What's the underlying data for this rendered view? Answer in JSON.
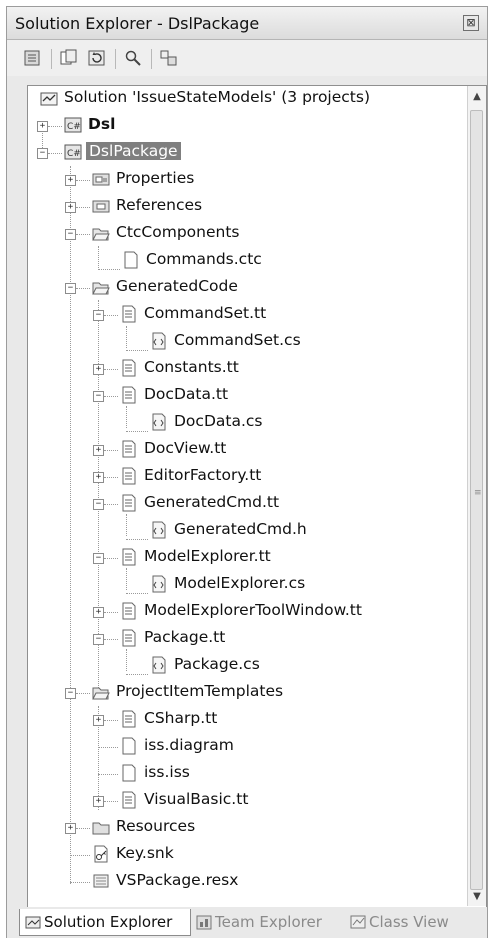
{
  "window": {
    "title": "Solution Explorer - DslPackage",
    "close_glyph": "⊠"
  },
  "toolbar": {
    "buttons": [
      "properties-icon",
      "show-all-files-icon",
      "refresh-icon",
      "view-code-icon",
      "view-designer-icon"
    ]
  },
  "tree": {
    "solution": "Solution 'IssueStateModels' (3 projects)",
    "dsl": "Dsl",
    "dslpackage": "DslPackage",
    "properties": "Properties",
    "references": "References",
    "ctccomponents": "CtcComponents",
    "commands_ctc": "Commands.ctc",
    "generatedcode": "GeneratedCode",
    "commandset_tt": "CommandSet.tt",
    "commandset_cs": "CommandSet.cs",
    "constants_tt": "Constants.tt",
    "docdata_tt": "DocData.tt",
    "docdata_cs": "DocData.cs",
    "docview_tt": "DocView.tt",
    "editorfactory_tt": "EditorFactory.tt",
    "generatedcmd_tt": "GeneratedCmd.tt",
    "generatedcmd_h": "GeneratedCmd.h",
    "modelexplorer_tt": "ModelExplorer.tt",
    "modelexplorer_cs": "ModelExplorer.cs",
    "modelexplorertoolwindow_tt": "ModelExplorerToolWindow.tt",
    "package_tt": "Package.tt",
    "package_cs": "Package.cs",
    "projectitemtemplates": "ProjectItemTemplates",
    "csharp_tt": "CSharp.tt",
    "iss_diagram": "iss.diagram",
    "iss_iss": "iss.iss",
    "visualbasic_tt": "VisualBasic.tt",
    "resources": "Resources",
    "key_snk": "Key.snk",
    "vspackage_resx": "VSPackage.resx"
  },
  "tabs": {
    "solution_explorer": "Solution Explorer",
    "team_explorer": "Team Explorer",
    "class_view": "Class View"
  }
}
